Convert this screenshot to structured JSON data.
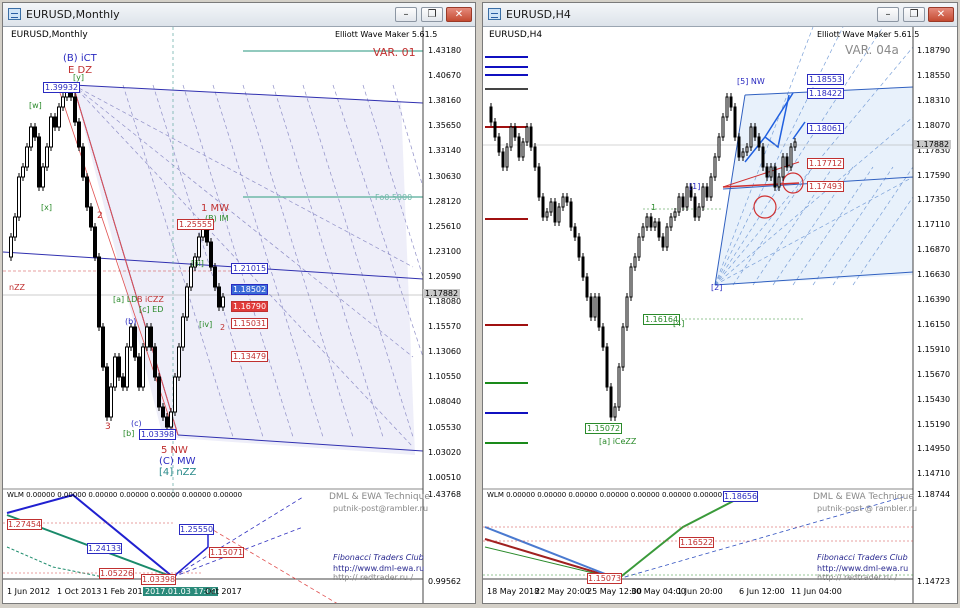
{
  "left": {
    "window_title": "EURUSD,Monthly",
    "chart_label": "EURUSD,Monthly",
    "indicator": "Elliott Wave Maker 5.61.5",
    "variant": "VAR. 01",
    "price_axis": [
      "1.43180",
      "1.40670",
      "1.38160",
      "1.35650",
      "1.33140",
      "1.30630",
      "1.28120",
      "1.25610",
      "1.23100",
      "1.20590",
      "1.18080",
      "1.15570",
      "1.13060",
      "1.10550",
      "1.08040",
      "1.05530",
      "1.03020",
      "1.00510"
    ],
    "current_price": "1.17882",
    "oscillator_axis": [
      "1.43768",
      "0.99562"
    ],
    "time_axis": [
      "1 Jun 2012",
      "1 Oct 2013",
      "1 Feb 2015",
      "2017.01.03 17:00",
      "Oct 2017"
    ],
    "wave_labels": {
      "b_ict": "(B) iCT",
      "e_dz": "E DZ",
      "w1": "[w]",
      "x1": "[x]",
      "y1": "[y]",
      "n2": "2",
      "n3": "3",
      "nzz": "nZZ",
      "a_ld": "[a] LD",
      "b_iczz": "B iCZZ",
      "c_ed": "[c] ED",
      "b_small": "(b)",
      "c_small": "(c)",
      "b_bracket": "[b]",
      "iii": "[iii]",
      "iv": "[iv]",
      "five_nw": "5 NW",
      "c_mw": "(C) MW",
      "four_nzz": "[4] nZZ",
      "one_mw": "1 MW",
      "b_im": "(B) IM",
      "n2b": "2"
    },
    "price_boxes": {
      "top": "1.39932",
      "p125": "1.25555",
      "p121": "1.21015",
      "p118": "1.18502",
      "p116": "1.16790",
      "p115": "1.15031",
      "p113": "1.13479",
      "p103": "1.03398"
    },
    "fib_label": "Fo0.5000",
    "osc_header": "WLM 0.00000 0.00000 0.00000 0.00000 0.00000 0.00000 0.00000",
    "osc_boxes": {
      "b1": "1.25550",
      "b2": "1.15071",
      "b3": "1.24133",
      "b4": "1.27454",
      "b5": "1.05226",
      "b6": "1.03398"
    },
    "credits": [
      "DML & EWA Technique",
      "putnik-post@rambler.ru",
      "Fibonacci Traders Club",
      "http://www.dml-ewa.ru",
      "http:// redtrader.ru /"
    ]
  },
  "right": {
    "window_title": "EURUSD,H4",
    "chart_label": "EURUSD,H4",
    "indicator": "Elliott Wave Maker 5.61.5",
    "variant": "VAR. 04a",
    "price_axis": [
      "1.18790",
      "1.18550",
      "1.18310",
      "1.18070",
      "1.17830",
      "1.17590",
      "1.17350",
      "1.17110",
      "1.16870",
      "1.16630",
      "1.16390",
      "1.16150",
      "1.15910",
      "1.15670",
      "1.15430",
      "1.15190",
      "1.14950",
      "1.14710"
    ],
    "current_price": "1.17882",
    "oscillator_axis": [
      "1.18744",
      "1.14723"
    ],
    "time_axis": [
      "18 May 2018",
      "22 May 20:00",
      "25 May 12:00",
      "30 May 04:00",
      "1 Jun 20:00",
      "6 Jun 12:00",
      "11 Jun 04:00"
    ],
    "price_boxes": {
      "p1855": "1.18553",
      "p1842": "1.18422",
      "p1806": "1.18061",
      "p1771": "1.17712",
      "p1749": "1.17493",
      "p1616": "1.16164",
      "p1507": "1.15072"
    },
    "wave_labels": {
      "s_nw": "[5] NW",
      "one": "[1]",
      "two": "[2]",
      "a_iczz": "[a] iCeZZ",
      "n1": "1",
      "n4": "[4]"
    },
    "osc_header": "WLM 0.00000 0.00000 0.00000 0.00000 0.00000 0.00000 0.00000",
    "osc_boxes": {
      "b1": "1.18656",
      "b2": "1.16522",
      "b3": "1.15073"
    },
    "credits": [
      "DML & EWA Technique",
      "putnik-post @ rambler.ru",
      "Fibonacci Traders Club",
      "http://www.dml-ewa.ru",
      "http:// redtrader.ru /"
    ]
  }
}
